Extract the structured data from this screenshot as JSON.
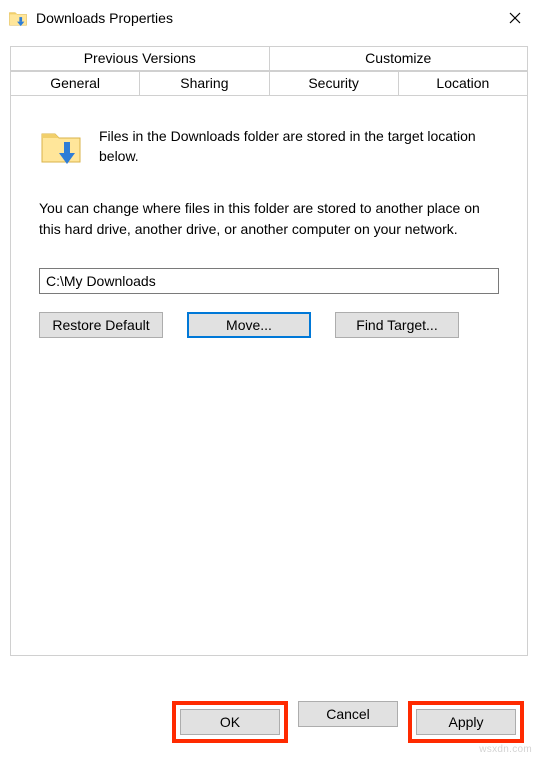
{
  "window": {
    "title": "Downloads Properties"
  },
  "tabs": {
    "row1": [
      "Previous Versions",
      "Customize"
    ],
    "row2": [
      "General",
      "Sharing",
      "Security",
      "Location"
    ],
    "active": "Location"
  },
  "panel": {
    "line1": "Files in the Downloads folder are stored in the target location below.",
    "para": "You can change where files in this folder are stored to another place on this hard drive, another drive, or another computer on your network.",
    "path_value": "C:\\My Downloads",
    "buttons": {
      "restore": "Restore Default",
      "move": "Move...",
      "find": "Find Target..."
    }
  },
  "footer": {
    "ok": "OK",
    "cancel": "Cancel",
    "apply": "Apply"
  },
  "watermark": "wsxdn.com"
}
